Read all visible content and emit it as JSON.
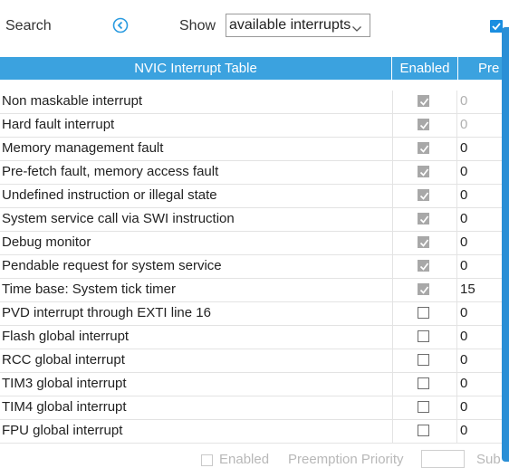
{
  "toolbar": {
    "search_label": "Search",
    "search_icon": "search-clear-icon",
    "show_label": "Show",
    "show_value": "available interrupts"
  },
  "table": {
    "headers": {
      "name": "NVIC Interrupt Table",
      "enabled": "Enabled",
      "priority": "Pre"
    },
    "rows": [
      {
        "name": "Non maskable interrupt",
        "enabled": true,
        "priority": "0",
        "editable": false
      },
      {
        "name": "Hard fault interrupt",
        "enabled": true,
        "priority": "0",
        "editable": false
      },
      {
        "name": "Memory management fault",
        "enabled": true,
        "priority": "0",
        "editable": true
      },
      {
        "name": "Pre-fetch fault, memory access fault",
        "enabled": true,
        "priority": "0",
        "editable": true
      },
      {
        "name": "Undefined instruction or illegal state",
        "enabled": true,
        "priority": "0",
        "editable": true
      },
      {
        "name": "System service call via SWI instruction",
        "enabled": true,
        "priority": "0",
        "editable": true
      },
      {
        "name": "Debug monitor",
        "enabled": true,
        "priority": "0",
        "editable": true
      },
      {
        "name": "Pendable request for system service",
        "enabled": true,
        "priority": "0",
        "editable": true
      },
      {
        "name": "Time base: System tick timer",
        "enabled": true,
        "priority": "15",
        "editable": true
      },
      {
        "name": "PVD interrupt through EXTI line 16",
        "enabled": false,
        "priority": "0",
        "editable": true
      },
      {
        "name": "Flash global interrupt",
        "enabled": false,
        "priority": "0",
        "editable": true
      },
      {
        "name": "RCC global interrupt",
        "enabled": false,
        "priority": "0",
        "editable": true
      },
      {
        "name": "TIM3 global interrupt",
        "enabled": false,
        "priority": "0",
        "editable": true
      },
      {
        "name": "TIM4 global interrupt",
        "enabled": false,
        "priority": "0",
        "editable": true
      },
      {
        "name": "FPU global interrupt",
        "enabled": false,
        "priority": "0",
        "editable": true
      }
    ]
  },
  "bottom": {
    "enabled_label": "Enabled",
    "priority_label": "Preemption Priority",
    "sub_label": "Sub"
  },
  "colors": {
    "header": "#3ba2df",
    "scrollbar": "#2a8fd6",
    "accent": "#1a8ee0"
  }
}
